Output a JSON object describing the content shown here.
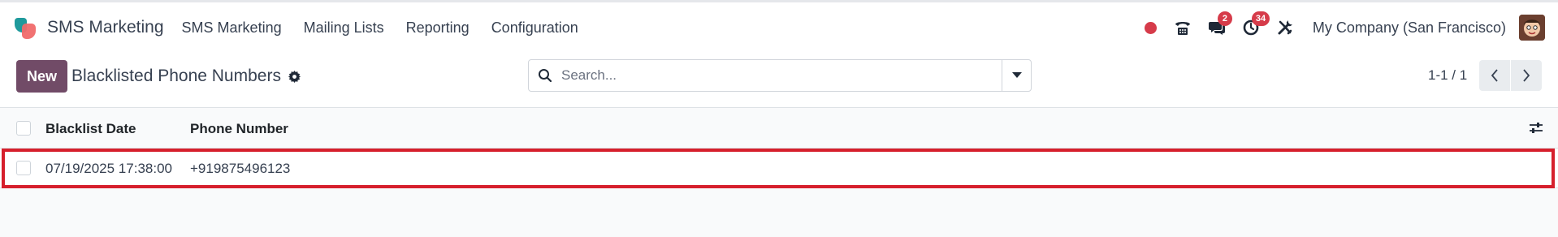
{
  "navbar": {
    "app_title": "SMS Marketing",
    "menu": [
      "SMS Marketing",
      "Mailing Lists",
      "Reporting",
      "Configuration"
    ],
    "systray": {
      "messages_count": "2",
      "activities_count": "34",
      "company": "My Company (San Francisco)"
    }
  },
  "control_panel": {
    "new_label": "New",
    "title": "Blacklisted Phone Numbers",
    "search_placeholder": "Search...",
    "pager": "1-1 / 1"
  },
  "list": {
    "columns": [
      "Blacklist Date",
      "Phone Number"
    ],
    "rows": [
      {
        "date": "07/19/2025 17:38:00",
        "phone": "+919875496123"
      }
    ]
  },
  "colors": {
    "primary": "#714b67",
    "badge": "#d63b4a",
    "highlight": "#d61f2c"
  }
}
